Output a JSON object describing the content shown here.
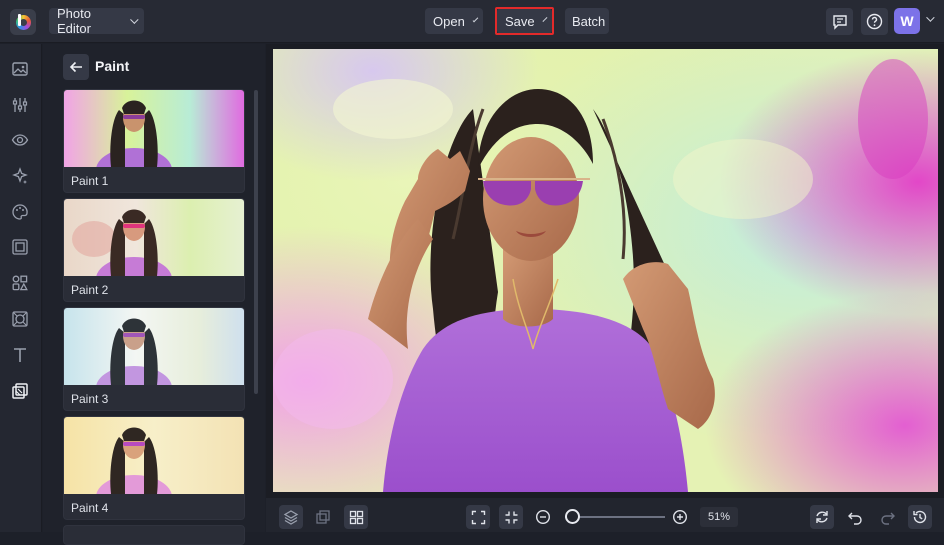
{
  "header": {
    "app_menu_label": "Photo Editor",
    "open_label": "Open",
    "save_label": "Save",
    "batch_label": "Batch",
    "avatar_initial": "W"
  },
  "panel": {
    "title": "Paint",
    "items": [
      {
        "label": "Paint 1"
      },
      {
        "label": "Paint 2"
      },
      {
        "label": "Paint 3"
      },
      {
        "label": "Paint 4"
      }
    ]
  },
  "rail": {
    "icons": [
      "image-icon",
      "adjust-sliders-icon",
      "eye-icon",
      "sparkle-icon",
      "palette-icon",
      "frame-icon",
      "elements-icon",
      "texture-icon",
      "text-icon",
      "effects-layers-icon"
    ]
  },
  "bottom": {
    "zoom_value": "51%"
  },
  "colors": {
    "accent": "#7c72e8",
    "save_highlight": "#e32a2a"
  }
}
